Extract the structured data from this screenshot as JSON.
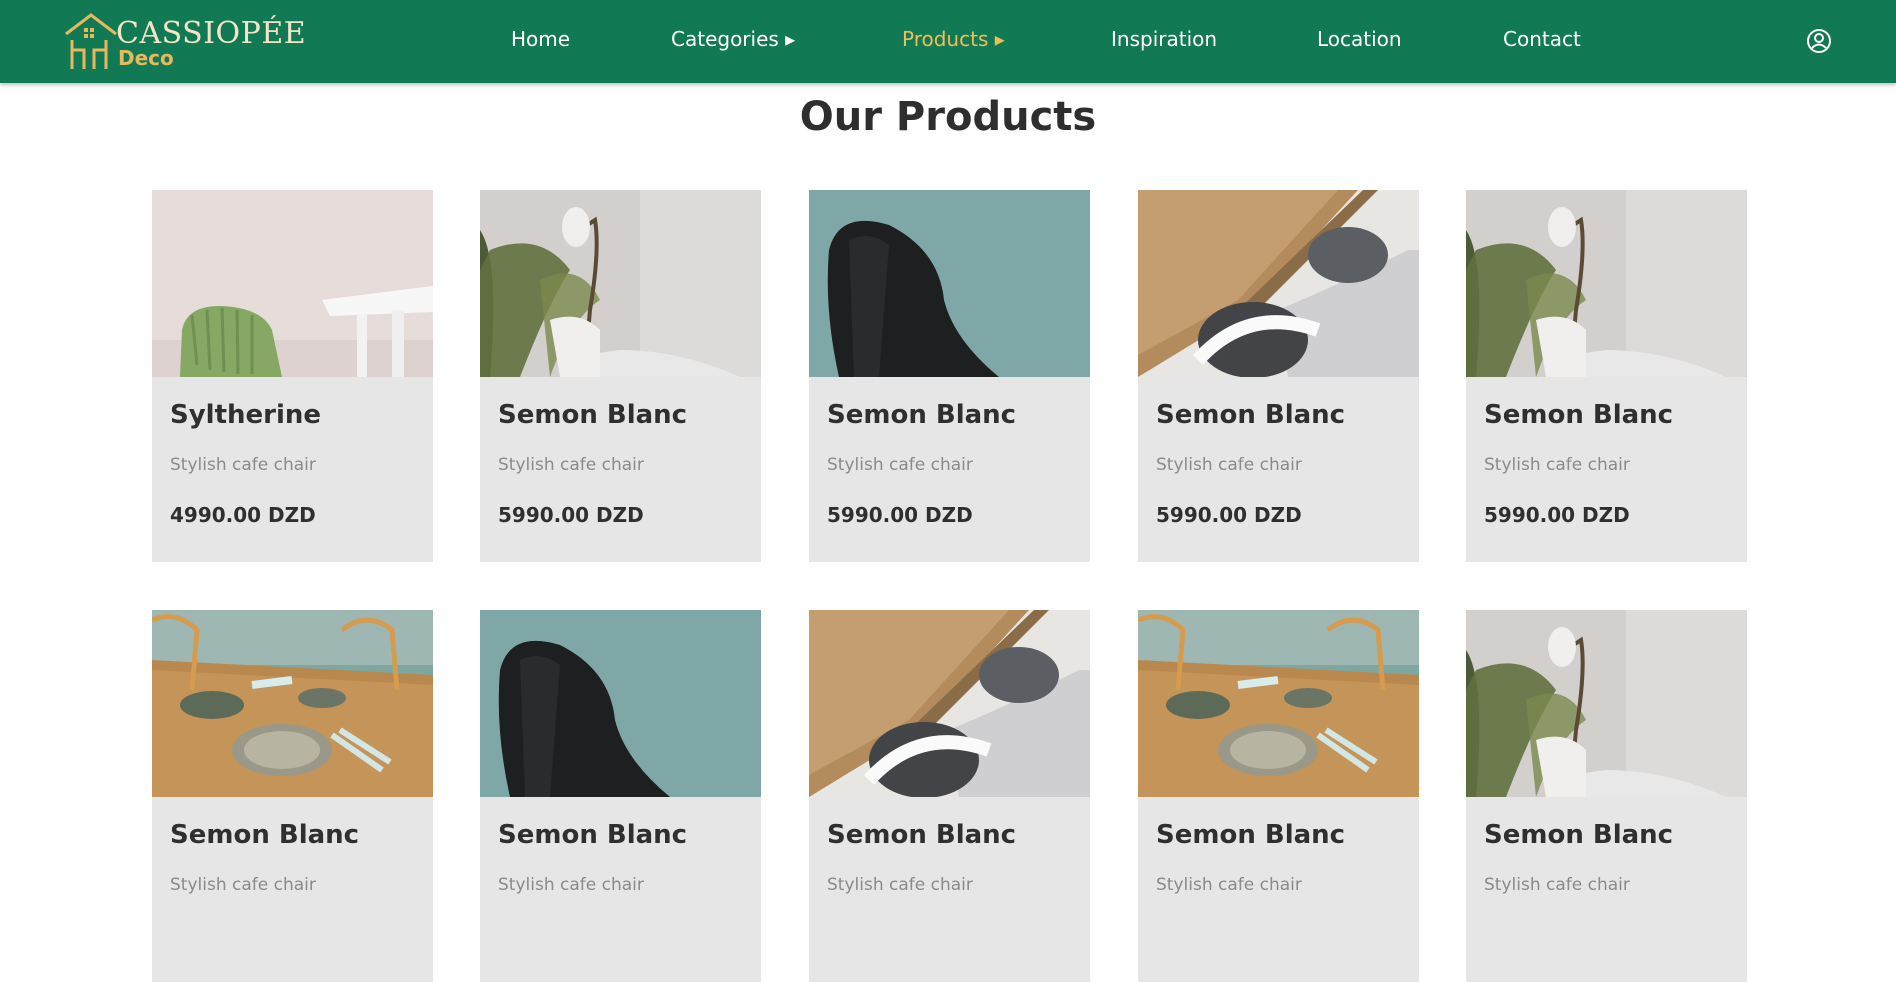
{
  "header": {
    "logo_main": "CASSIOPÉE",
    "logo_sub": "Deco",
    "nav": [
      {
        "label": "Home"
      },
      {
        "label": "Categories ▸"
      },
      {
        "label": "Products ▸"
      },
      {
        "label": "Inspiration"
      },
      {
        "label": "Location"
      },
      {
        "label": "Contact"
      }
    ],
    "active_nav": "Products ▸",
    "user_icon": "user-circle-icon"
  },
  "main": {
    "title": "Our Products"
  },
  "products": [
    {
      "name": "Syltherine",
      "description": "Stylish cafe chair",
      "price": "4990.00 DZD",
      "image": "green-chair"
    },
    {
      "name": "Semon Blanc",
      "description": "Stylish cafe chair",
      "price": "5990.00 DZD",
      "image": "plant-lamp-table"
    },
    {
      "name": "Semon Blanc",
      "description": "Stylish cafe chair",
      "price": "5990.00 DZD",
      "image": "black-chair-teal"
    },
    {
      "name": "Semon Blanc",
      "description": "Stylish cafe chair",
      "price": "5990.00 DZD",
      "image": "wood-table-chairs"
    },
    {
      "name": "Semon Blanc",
      "description": "Stylish cafe chair",
      "price": "5990.00 DZD",
      "image": "plant-lamp-table"
    },
    {
      "name": "Semon Blanc",
      "description": "Stylish cafe chair",
      "price": "",
      "image": "dining-table-plates"
    },
    {
      "name": "Semon Blanc",
      "description": "Stylish cafe chair",
      "price": "",
      "image": "black-chair-teal"
    },
    {
      "name": "Semon Blanc",
      "description": "Stylish cafe chair",
      "price": "",
      "image": "wood-table-chairs"
    },
    {
      "name": "Semon Blanc",
      "description": "Stylish cafe chair",
      "price": "",
      "image": "dining-table-plates"
    },
    {
      "name": "Semon Blanc",
      "description": "Stylish cafe chair",
      "price": "",
      "image": "plant-lamp-table"
    }
  ],
  "colors": {
    "nav_bg": "#117a55",
    "accent": "#f1bd57",
    "card_bg": "#e6e6e6",
    "title": "#2e2e2e"
  }
}
